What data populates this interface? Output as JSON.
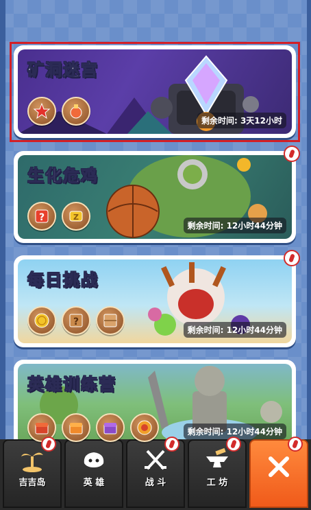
{
  "cards": [
    {
      "id": "mine",
      "title": "矿洞迷宫",
      "timer": "剩余时间: 3天12小时"
    },
    {
      "id": "bio",
      "title": "生化危鸡",
      "timer": "剩余时间: 12小时44分钟"
    },
    {
      "id": "daily",
      "title": "每日挑战",
      "timer": "剩余时间: 12小时44分钟"
    },
    {
      "id": "hero",
      "title": "英雄训练营",
      "timer": "剩余时间: 12小时44分钟"
    }
  ],
  "nav": [
    {
      "label": "吉吉岛",
      "icon": "palm-tree-icon"
    },
    {
      "label": "英 雄",
      "icon": "hero-head-icon"
    },
    {
      "label": "战 斗",
      "icon": "crossed-swords-icon"
    },
    {
      "label": "工 坊",
      "icon": "anvil-icon"
    },
    {
      "label": "",
      "icon": "close-icon"
    }
  ],
  "colors": {
    "accent_orange": "#f05a1a",
    "alert_red": "#d32b2b",
    "selection_red": "#d31f26",
    "background_blue": "#6a8fca"
  }
}
